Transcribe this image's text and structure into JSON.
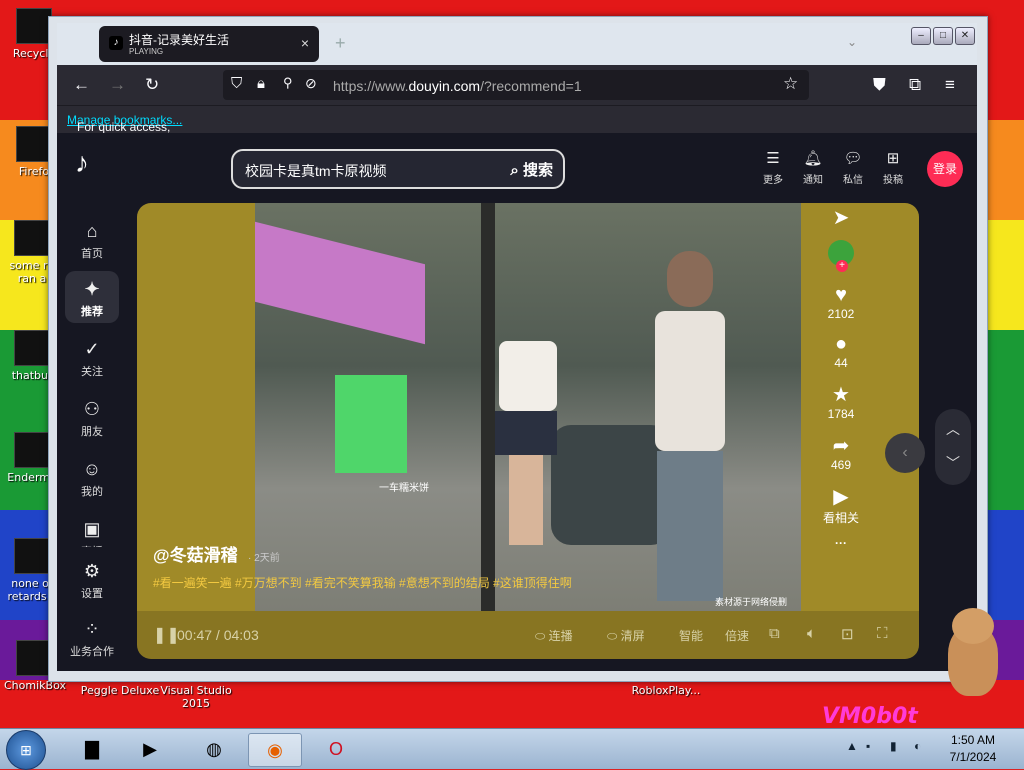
{
  "desktop": {
    "icons": [
      {
        "label": "Recycle",
        "name": "desktop-icon-recycle"
      },
      {
        "label": "Firefo",
        "name": "desktop-icon-firefox"
      },
      {
        "label": "some ru\nran a",
        "name": "desktop-icon-some-ru"
      },
      {
        "label": "thatbut",
        "name": "desktop-icon-thatbut"
      },
      {
        "label": "Enderma",
        "name": "desktop-icon-enderma"
      },
      {
        "label": "none of\nretards k",
        "name": "desktop-icon-none-of"
      },
      {
        "label": "ChomikBox",
        "name": "desktop-icon-chomikbox"
      },
      {
        "label": "Peggle Deluxe",
        "name": "desktop-icon-peggle"
      },
      {
        "label": "Visual Studio 2015",
        "name": "desktop-icon-visual-studio"
      },
      {
        "label": "RobloxPlay...",
        "name": "desktop-icon-roblox"
      }
    ],
    "vm_text": "VM0b0t"
  },
  "browser": {
    "tab": {
      "title": "抖音-记录美好生活",
      "status": "PLAYING",
      "close": "×"
    },
    "new_tab": "+",
    "url_prefix": "https://www.",
    "url_domain": "douyin.com",
    "url_suffix": "/?recommend=1",
    "bookmarks_text": "For quick access, place your bookmarks here on the bookmarks toolbar.",
    "bookmarks_link": "Manage bookmarks..."
  },
  "douyin": {
    "search_query": "校园卡是真tm卡原视频",
    "search_button": "搜索",
    "top_actions": [
      {
        "label": "更多",
        "icon": "menu-icon"
      },
      {
        "label": "通知",
        "icon": "bell-icon"
      },
      {
        "label": "私信",
        "icon": "message-icon"
      },
      {
        "label": "投稿",
        "icon": "upload-icon"
      }
    ],
    "login": "登录",
    "sidebar": [
      {
        "label": "首页",
        "icon": "home-icon"
      },
      {
        "label": "推荐",
        "icon": "sparkle-icon"
      },
      {
        "label": "关注",
        "icon": "follow-icon"
      },
      {
        "label": "朋友",
        "icon": "friends-icon"
      },
      {
        "label": "我的",
        "icon": "profile-icon"
      },
      {
        "label": "直播",
        "icon": "live-icon"
      },
      {
        "label": "设置",
        "icon": "settings-icon"
      },
      {
        "label": "业务合作",
        "icon": "business-icon"
      }
    ],
    "video": {
      "author": "@冬菇滑稽",
      "posted": "· 2天前",
      "tags": "#看一遍笑一遍 #万万想不到 #看完不笑算我输 #意想不到的结局 #这谁顶得住啊",
      "source_note": "素材源于网络侵删",
      "overlay_text": "一车糯米饼",
      "likes": "2102",
      "comments": "44",
      "favorites": "1784",
      "shares": "469",
      "related": "看相关",
      "more": "···",
      "time_current": "00:47",
      "time_total": "04:03",
      "options": [
        "连播",
        "清屏",
        "智能",
        "倍速"
      ]
    }
  },
  "taskbar": {
    "time": "1:50 AM",
    "date": "7/1/2024"
  }
}
